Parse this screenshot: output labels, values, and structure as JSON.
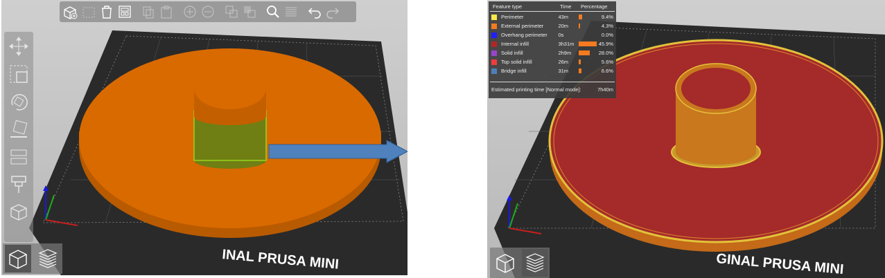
{
  "plate": {
    "label_left": "INAL PRUSA MINI",
    "label_right": "GINAL PRUSA MINI"
  },
  "toolbar": {
    "items": [
      "add-icon",
      "delete-icon",
      "delete-all-icon",
      "arrange-icon",
      "copy-icon",
      "paste-icon",
      "add-instance-icon",
      "remove-instance-icon",
      "split-objects-icon",
      "split-parts-icon",
      "search-icon",
      "layers-icon",
      "undo-icon",
      "redo-icon"
    ]
  },
  "side_toolbar": {
    "items": [
      "move-icon",
      "scale-icon",
      "rotate-icon",
      "place-on-face-icon",
      "cut-icon",
      "paint-supports-icon",
      "seam-icon"
    ]
  },
  "legend": {
    "headers": {
      "type": "Feature type",
      "time": "Time",
      "percentage": "Percentage"
    },
    "rows": [
      {
        "name": "Perimeter",
        "time": "43m",
        "pct": "9.4%",
        "value": 9.4,
        "color": "#ffe94a"
      },
      {
        "name": "External perimeter",
        "time": "20m",
        "pct": "4.3%",
        "value": 4.3,
        "color": "#f47b20"
      },
      {
        "name": "Overhang perimeter",
        "time": "0s",
        "pct": "0.0%",
        "value": 0.0,
        "color": "#1f1fff"
      },
      {
        "name": "Internal infill",
        "time": "3h31m",
        "pct": "45.9%",
        "value": 45.9,
        "color": "#b12626"
      },
      {
        "name": "Solid infill",
        "time": "2h9m",
        "pct": "28.0%",
        "value": 28.0,
        "color": "#9a44cc"
      },
      {
        "name": "Top solid infill",
        "time": "26m",
        "pct": "5.6%",
        "value": 5.6,
        "color": "#f03c3c"
      },
      {
        "name": "Bridge infill",
        "time": "31m",
        "pct": "6.6%",
        "value": 6.6,
        "color": "#4d80ba"
      }
    ],
    "footer": {
      "label": "Estimated printing time [Normal mode]:",
      "value": "7h40m"
    }
  },
  "colors": {
    "model_orange": "#d96a00",
    "cylinder_selected": "#7a8a1a",
    "infill_red": "#a52a2a",
    "bed": "#2a2a2a",
    "arrow": "#4f81bd"
  }
}
